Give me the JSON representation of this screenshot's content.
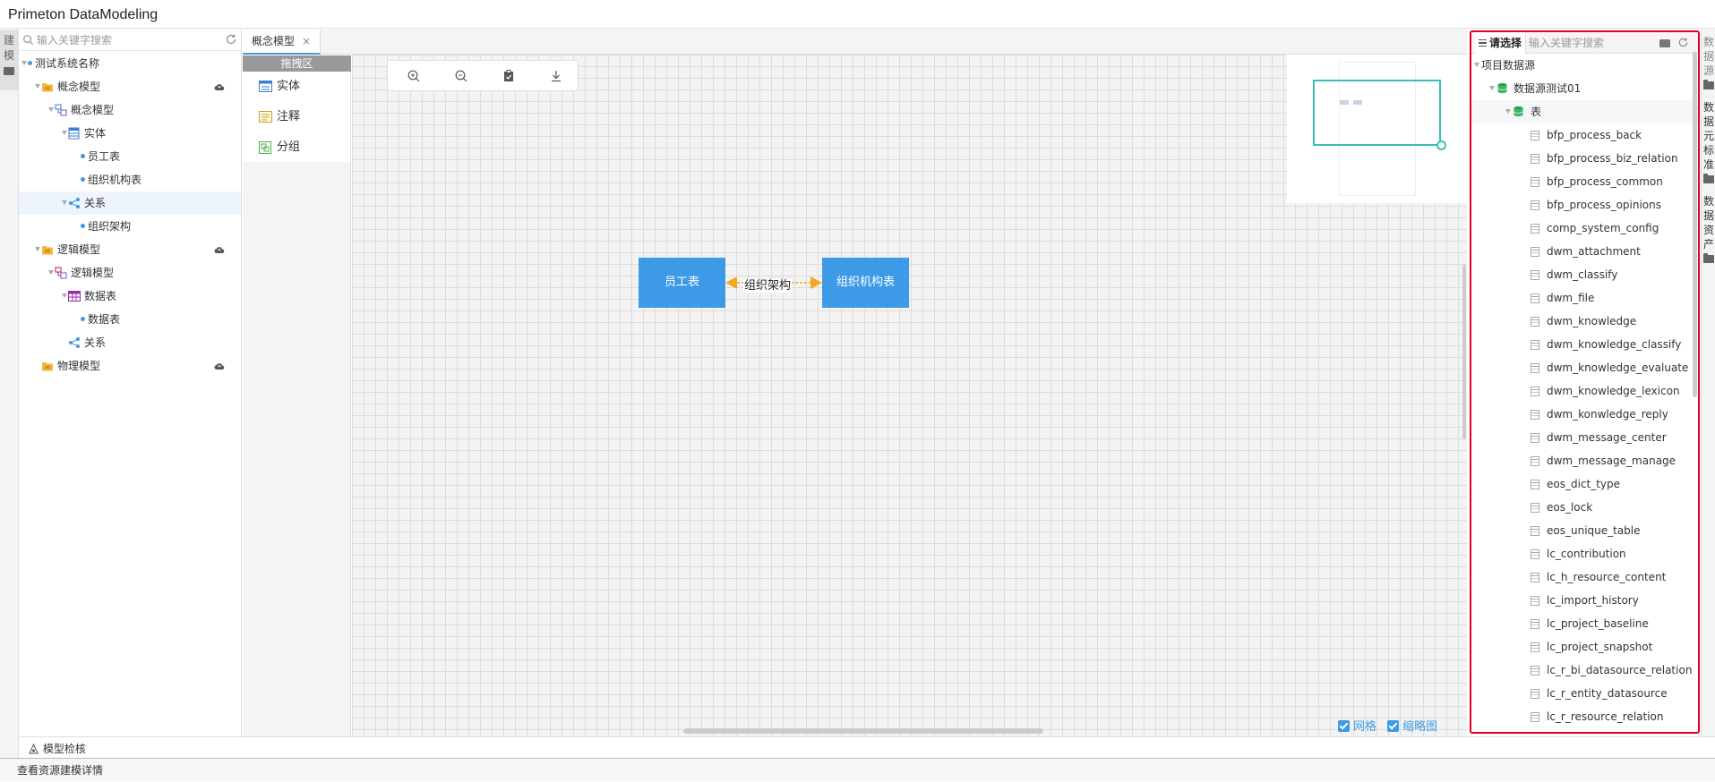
{
  "app": {
    "title": "Primeton DataModeling"
  },
  "left_strip": {
    "tab_label": "建模"
  },
  "tree": {
    "search_placeholder": "输入关键字搜索",
    "items": [
      {
        "label": "测试系统名称",
        "level": 0,
        "icon": "dot-icon"
      },
      {
        "label": "概念模型",
        "level": 1,
        "icon": "folder-icon",
        "cloud": true
      },
      {
        "label": "概念模型",
        "level": 2,
        "icon": "concept-model-icon"
      },
      {
        "label": "实体",
        "level": 3,
        "icon": "entity-icon"
      },
      {
        "label": "员工表",
        "level": 4,
        "icon": "dot-icon"
      },
      {
        "label": "组织机构表",
        "level": 4,
        "icon": "dot-icon"
      },
      {
        "label": "关系",
        "level": 3,
        "icon": "relation-icon",
        "selected": true
      },
      {
        "label": "组织架构",
        "level": 4,
        "icon": "dot-icon"
      },
      {
        "label": "逻辑模型",
        "level": 1,
        "icon": "folder-icon",
        "cloud": true
      },
      {
        "label": "逻辑模型",
        "level": 2,
        "icon": "logic-model-icon"
      },
      {
        "label": "数据表",
        "level": 3,
        "icon": "datatable-icon"
      },
      {
        "label": "数据表",
        "level": 4,
        "icon": "dot-icon"
      },
      {
        "label": "关系",
        "level": 3,
        "icon": "relation-icon"
      },
      {
        "label": "物理模型",
        "level": 1,
        "icon": "folder-icon",
        "cloud": true
      }
    ]
  },
  "editor": {
    "tab_label": "概念模型",
    "palette": {
      "header": "拖拽区",
      "items": [
        {
          "label": "实体",
          "icon": "entity-icon"
        },
        {
          "label": "注释",
          "icon": "note-icon"
        },
        {
          "label": "分组",
          "icon": "group-icon"
        }
      ]
    },
    "toolbar": [
      "zoom-in-icon",
      "zoom-out-icon",
      "clipboard-icon",
      "download-icon"
    ],
    "diagram": {
      "entities": [
        "员工表",
        "组织机构表"
      ],
      "relation_label": "组织架构"
    },
    "options": {
      "grid_label": "网格",
      "grid_checked": true,
      "minimap_label": "缩略图",
      "minimap_checked": true
    }
  },
  "datasource": {
    "select_label": "请选择",
    "search_placeholder": "输入关键字搜索",
    "root": "项目数据源",
    "source": "数据源测试01",
    "group": "表",
    "tables": [
      "bfp_process_back",
      "bfp_process_biz_relation",
      "bfp_process_common",
      "bfp_process_opinions",
      "comp_system_config",
      "dwm_attachment",
      "dwm_classify",
      "dwm_file",
      "dwm_knowledge",
      "dwm_knowledge_classify",
      "dwm_knowledge_evaluate",
      "dwm_knowledge_lexicon",
      "dwm_konwledge_reply",
      "dwm_message_center",
      "dwm_message_manage",
      "eos_dict_type",
      "eos_lock",
      "eos_unique_table",
      "lc_contribution",
      "lc_h_resource_content",
      "lc_import_history",
      "lc_project_baseline",
      "lc_project_snapshot",
      "lc_r_bi_datasource_relation",
      "lc_r_entity_datasource",
      "lc_r_resource_relation"
    ]
  },
  "right_strip": {
    "tabs": [
      "数据源",
      "数据元标准",
      "数据资产"
    ]
  },
  "bottom": {
    "check_label": "模型检核",
    "status_text": "查看资源建模详情"
  }
}
